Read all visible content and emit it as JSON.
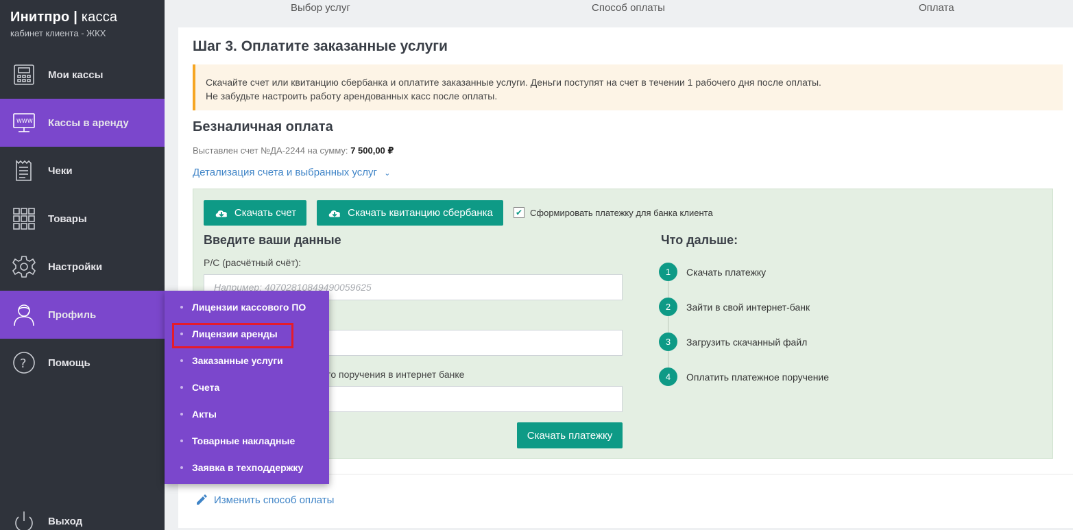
{
  "brand": {
    "title_bold": "Инитпро",
    "title_sep": "|",
    "title_light": "касса",
    "subtitle": "кабинет клиента - ЖКХ"
  },
  "sidebar": {
    "items": [
      {
        "label": "Мои кассы",
        "icon": "cash-register-icon"
      },
      {
        "label": "Кассы в аренду",
        "icon": "www-monitor-icon",
        "active": true
      },
      {
        "label": "Чеки",
        "icon": "receipt-icon"
      },
      {
        "label": "Товары",
        "icon": "grid-icon"
      },
      {
        "label": "Настройки",
        "icon": "gear-icon"
      },
      {
        "label": "Профиль",
        "icon": "user-icon",
        "active": true
      },
      {
        "label": "Помощь",
        "icon": "question-icon"
      },
      {
        "label": "Выход",
        "icon": "power-icon"
      }
    ]
  },
  "profile_menu": {
    "items": [
      "Лицензии кассового ПО",
      "Лицензии аренды",
      "Заказанные услуги",
      "Счета",
      "Акты",
      "Товарные накладные",
      "Заявка в техподдержку"
    ],
    "highlighted": "Лицензии аренды"
  },
  "steps": [
    "Выбор услуг",
    "Способ оплаты",
    "Оплата"
  ],
  "main": {
    "title": "Шаг 3. Оплатите заказанные услуги",
    "notice_line1": "Скачайте счет или квитанцию сбербанка и оплатите заказанные услуги. Деньги поступят на счет в течении 1 рабочего дня после оплаты.",
    "notice_line2": "Не забудьте настроить работу арендованных касс после оплаты.",
    "section_title": "Безналичная оплата",
    "invoice_prefix": "Выставлен счет №ДА-2244 на сумму:",
    "invoice_amount": "7 500,00 ₽",
    "detail_link": "Детализация счета и выбранных услуг",
    "download_invoice": "Скачать счет",
    "download_sber": "Скачать квитанцию сбербанка",
    "checkbox_label": "Сформировать платежку для банка клиента",
    "checkbox_checked": true,
    "form_title": "Введите ваши данные",
    "account_label": "Р/С (расчётный счёт):",
    "account_placeholder": "Например: 40702810849490059625",
    "third_label_visible": "ного поручения в интернет банке",
    "download_payment": "Скачать платежку",
    "next_title": "Что дальше:",
    "next_steps": [
      {
        "num": "1",
        "text": "Скачать платежку"
      },
      {
        "num": "2",
        "text": "Зайти в свой интернет-банк"
      },
      {
        "num": "3",
        "text": "Загрузить скачанный файл"
      },
      {
        "num": "4",
        "text": "Оплатить платежное поручение"
      }
    ],
    "change_payment": "Изменить способ оплаты"
  },
  "colors": {
    "sidebar_bg": "#2f333b",
    "accent_purple": "#7b47cc",
    "teal": "#0e9a86",
    "link_blue": "#3f84c7",
    "highlight_red": "#e51b2a"
  }
}
